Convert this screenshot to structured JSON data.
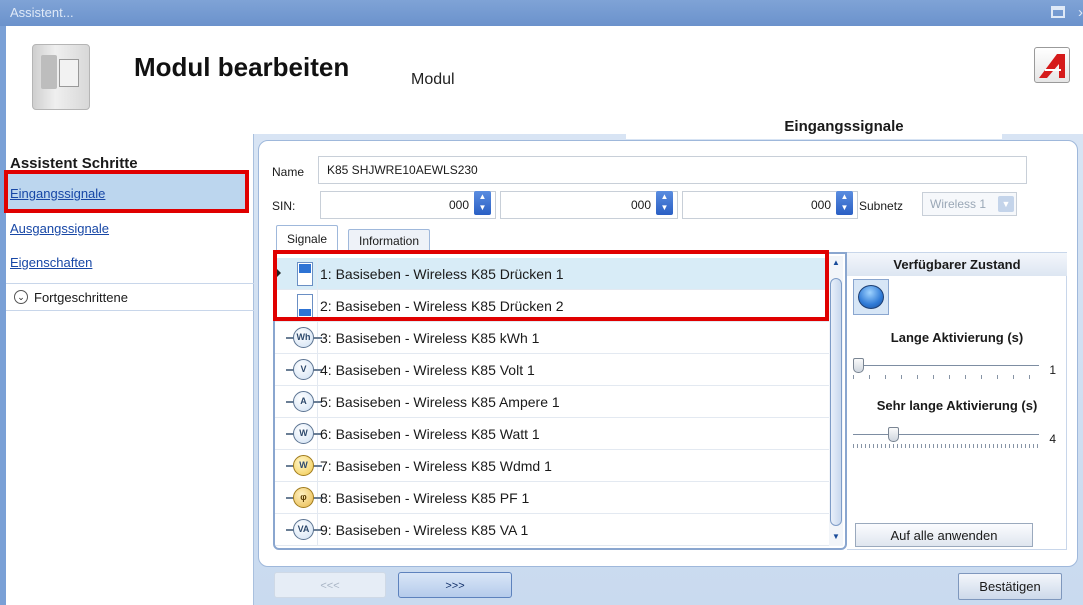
{
  "window": {
    "title": "Assistent..."
  },
  "header": {
    "heading": "Modul bearbeiten",
    "subtitle": "Modul",
    "section_tab": "Eingangssignale"
  },
  "sidebar": {
    "heading": "Assistent Schritte",
    "items": [
      {
        "label": "Eingangssignale"
      },
      {
        "label": "Ausgangssignale"
      },
      {
        "label": "Eigenschaften"
      }
    ],
    "advanced_label": "Fortgeschrittene"
  },
  "form": {
    "name_label": "Name",
    "name_value": "K85 SHJWRE10AEWLS230",
    "sin_label": "SIN:",
    "sin_values": [
      "000",
      "000",
      "000"
    ],
    "subnetz_label": "Subnetz",
    "subnetz_value": "Wireless 1"
  },
  "tabs": [
    {
      "label": "Signale"
    },
    {
      "label": "Information"
    }
  ],
  "signals": [
    {
      "label": "1: Basiseben - Wireless K85 Drücken 1",
      "icon": "button-pressed-icon",
      "selected": true
    },
    {
      "label": "2: Basiseben - Wireless K85 Drücken 2",
      "icon": "button-released-icon"
    },
    {
      "label": "3: Basiseben - Wireless K85 kWh 1",
      "icon": "kwh-meter-icon",
      "sym": "Wh"
    },
    {
      "label": "4: Basiseben - Wireless K85 Volt 1",
      "icon": "volt-meter-icon",
      "sym": "V"
    },
    {
      "label": "5: Basiseben - Wireless K85 Ampere 1",
      "icon": "ampere-meter-icon",
      "sym": "A"
    },
    {
      "label": "6: Basiseben - Wireless K85 Watt 1",
      "icon": "watt-meter-icon",
      "sym": "W"
    },
    {
      "label": "7: Basiseben - Wireless K85 Wdmd 1",
      "icon": "wdmd-meter-icon",
      "sym": "W"
    },
    {
      "label": "8: Basiseben - Wireless K85 PF 1",
      "icon": "power-factor-icon",
      "sym": "φ"
    },
    {
      "label": "9: Basiseben - Wireless K85 VA 1",
      "icon": "va-meter-icon",
      "sym": "VA"
    }
  ],
  "right_panel": {
    "state_heading": "Verfügbarer Zustand",
    "long_label": "Lange Aktivierung (s)",
    "long_value": "1",
    "long_level": 0,
    "very_long_label": "Sehr lange Aktivierung (s)",
    "very_long_value": "4",
    "very_long_level": 0.2,
    "apply_label": "Auf alle anwenden"
  },
  "footer": {
    "prev_label": "<<<",
    "next_label": ">>>",
    "confirm_label": "Bestätigen"
  },
  "colors": {
    "highlight": "#e00000",
    "accent": "#2d73d4",
    "link": "#1747a6"
  }
}
